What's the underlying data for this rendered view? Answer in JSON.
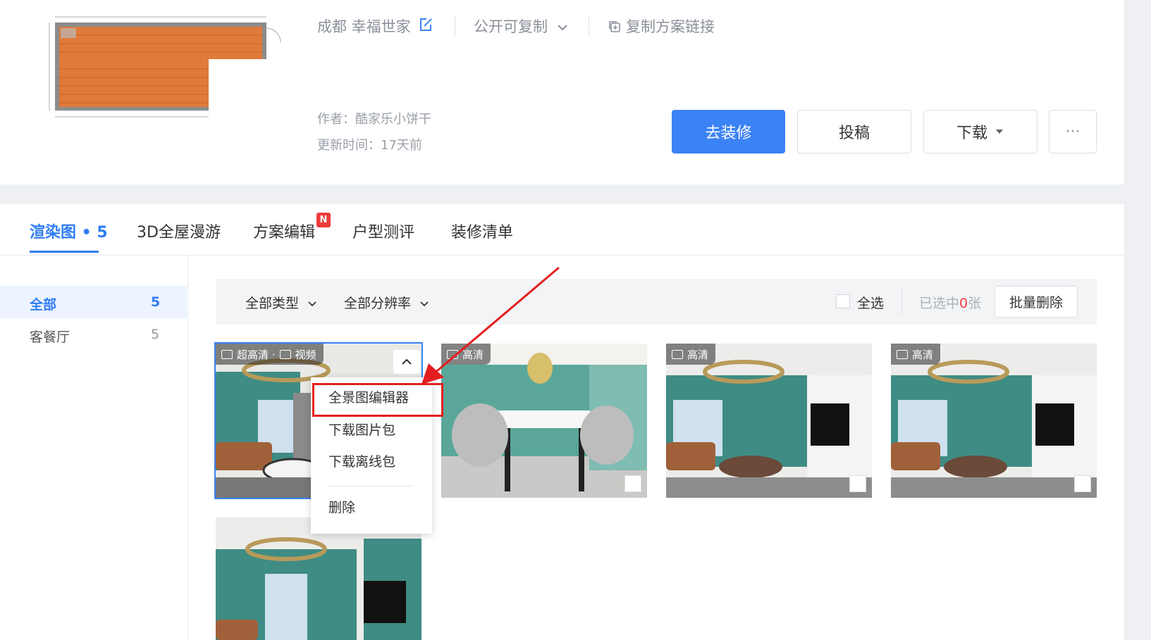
{
  "project": {
    "title": "成都 幸福世家",
    "share_mode": "公开可复制",
    "copy_link": "复制方案链接",
    "author": "作者：酷家乐小饼干",
    "update_time": "更新时间：17天前"
  },
  "actions": {
    "renovate": "去装修",
    "submit": "投稿",
    "download": "下载",
    "more": "···"
  },
  "tabs": {
    "render": "渲染图 • 5",
    "tour3d": "3D全屋漫游",
    "edit": "方案编辑",
    "edit_badge": "N",
    "evaluate": "户型测评",
    "shopping": "装修清单"
  },
  "sidebar": {
    "items": [
      {
        "label": "全部",
        "count": "5"
      },
      {
        "label": "客餐厅",
        "count": "5"
      }
    ]
  },
  "filters": {
    "type": "全部类型",
    "resolution": "全部分辨率",
    "select_all": "全选",
    "selected_prefix": "已选中",
    "selected_num": "0",
    "selected_suffix": "张",
    "batch_delete": "批量删除"
  },
  "thumbnails": [
    {
      "tag": "超高清 ·",
      "tag2": "视频"
    },
    {
      "tag": "高清"
    },
    {
      "tag": "高清"
    },
    {
      "tag": "高清"
    },
    {
      "tag": ""
    }
  ],
  "menu": {
    "items": [
      "全景图编辑器",
      "下载图片包",
      "下载离线包",
      "删除"
    ]
  },
  "colors": {
    "primary": "#3b82f6",
    "highlight": "#e41e1e",
    "wall_teal": "#3f8c84"
  }
}
